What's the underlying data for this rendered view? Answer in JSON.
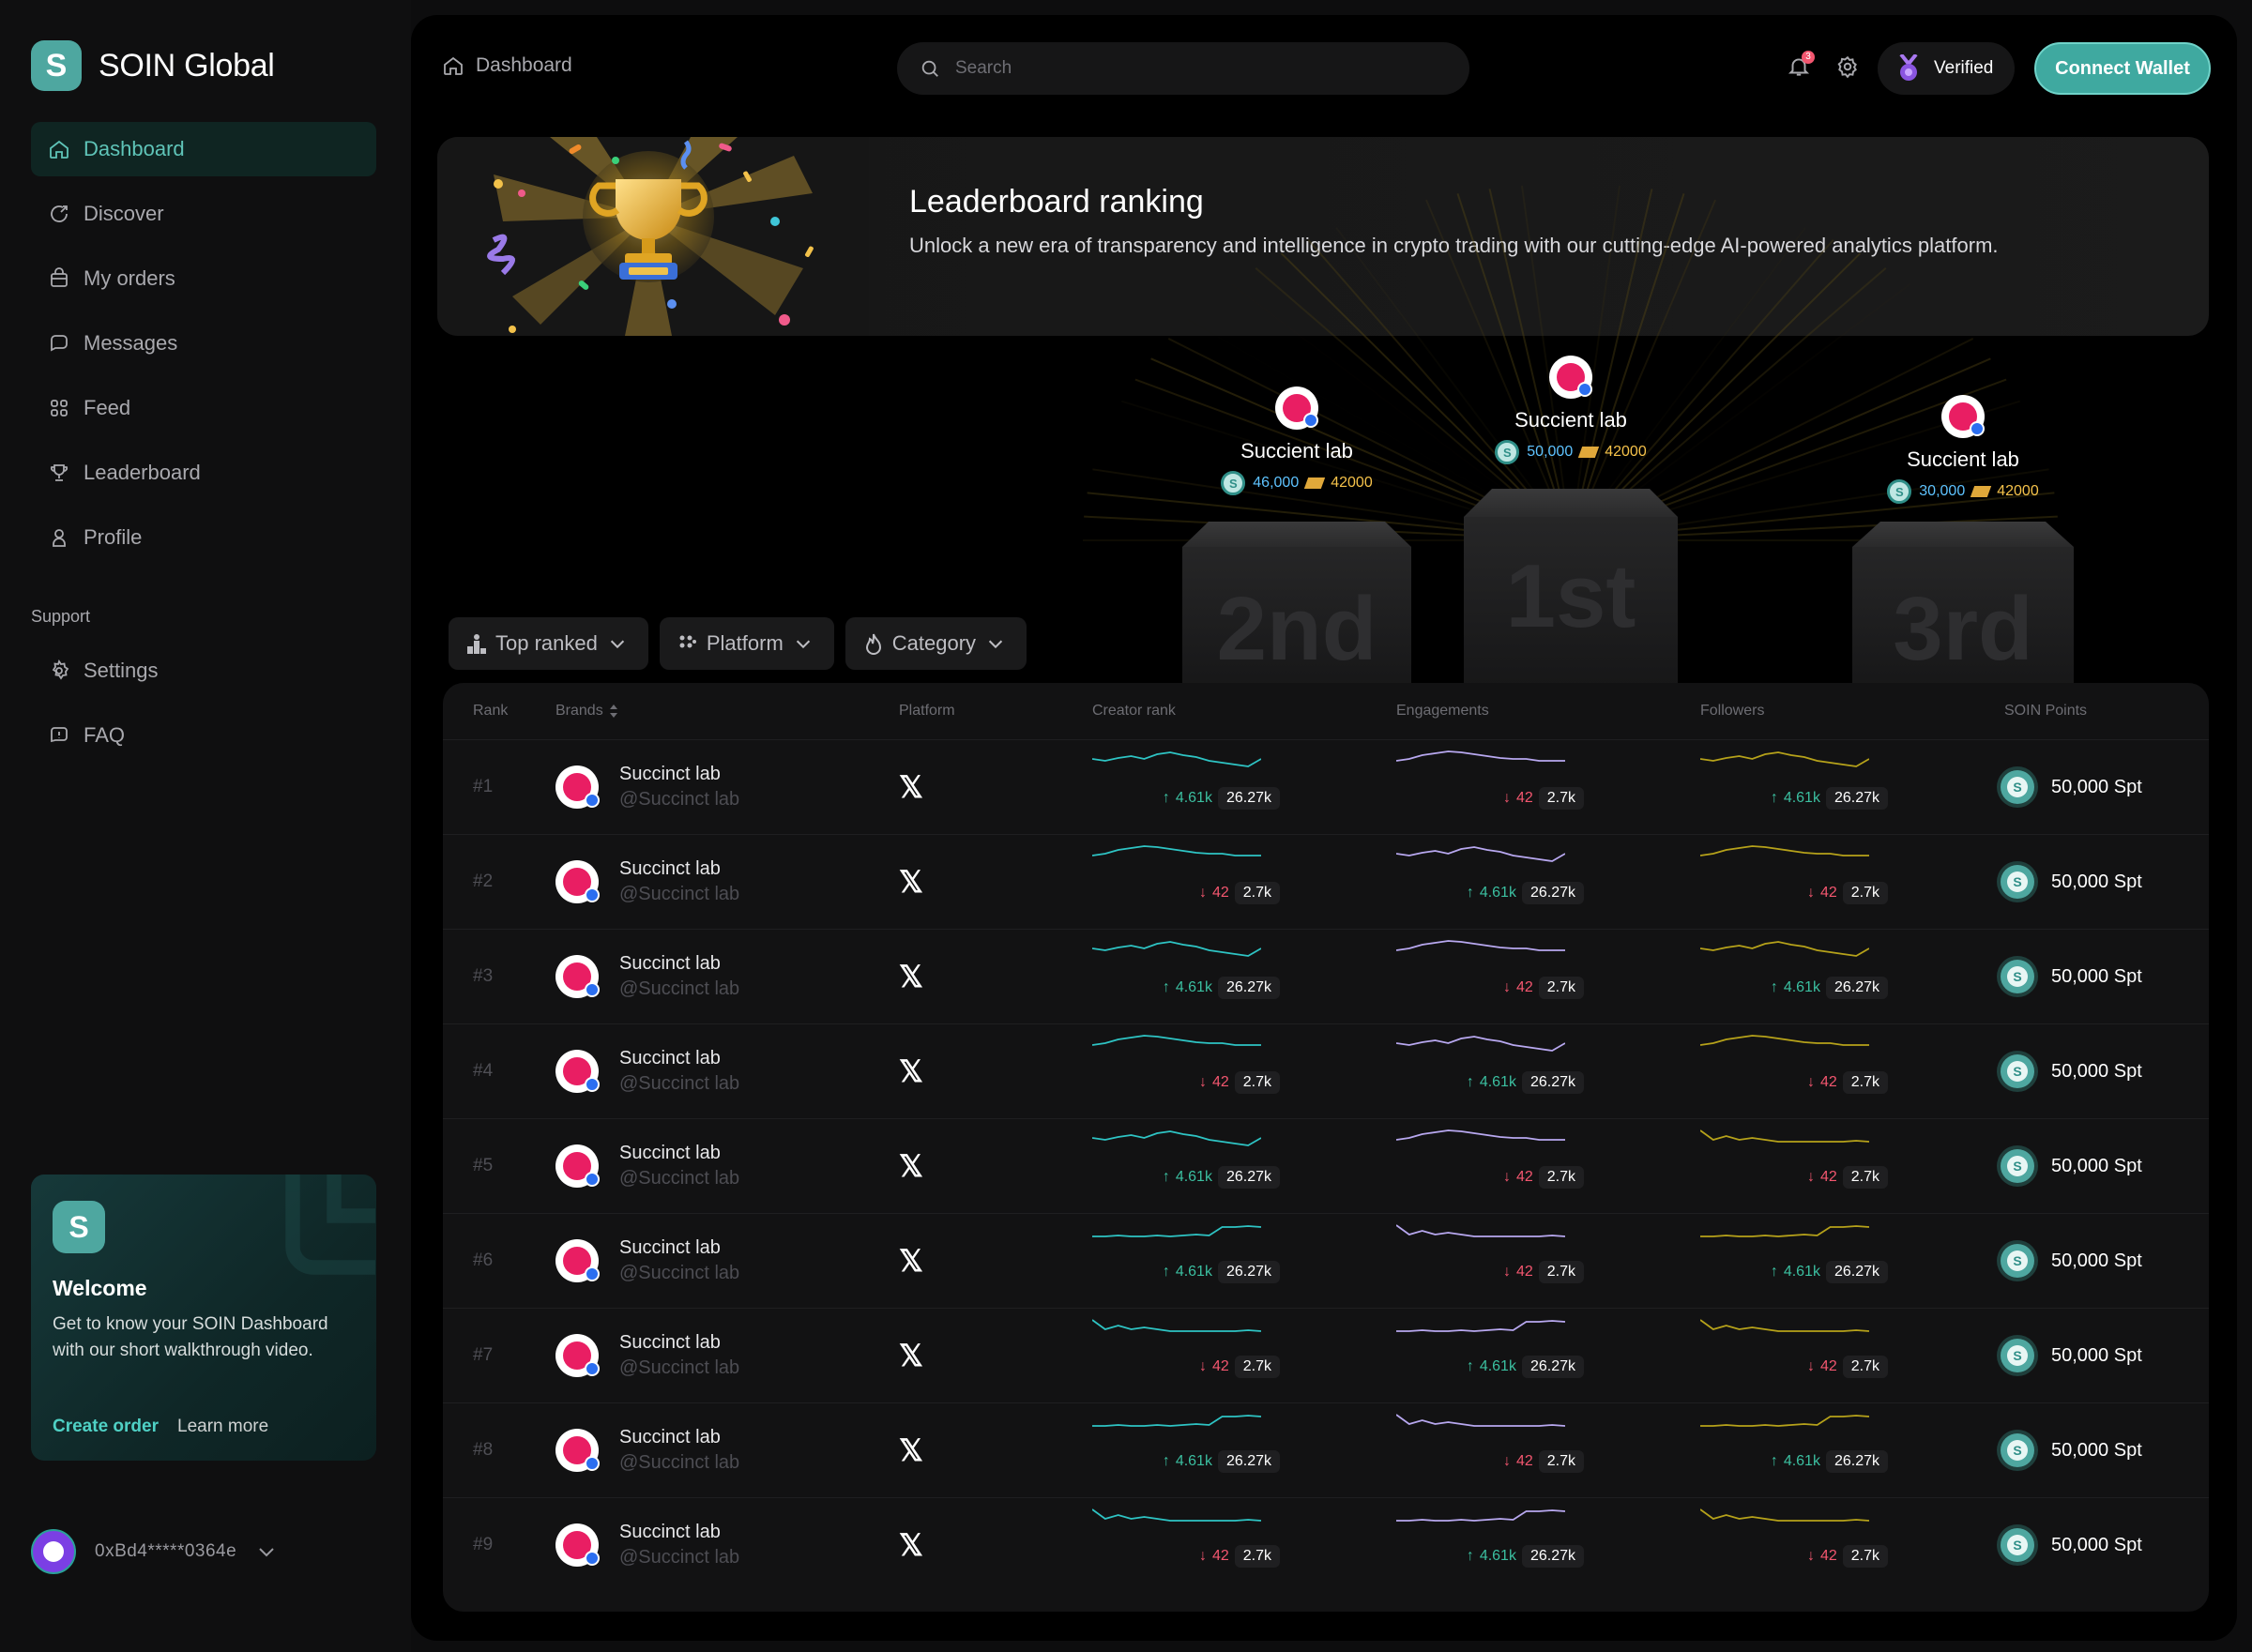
{
  "brand": {
    "name": "SOIN Global",
    "logo_letter": "S"
  },
  "nav": {
    "items": [
      {
        "label": "Dashboard",
        "icon": "home-icon",
        "active": true
      },
      {
        "label": "Discover",
        "icon": "discover-icon"
      },
      {
        "label": "My orders",
        "icon": "orders-icon"
      },
      {
        "label": "Messages",
        "icon": "messages-icon"
      },
      {
        "label": "Feed",
        "icon": "feed-icon"
      },
      {
        "label": "Leaderboard",
        "icon": "trophy-icon"
      },
      {
        "label": "Profile",
        "icon": "profile-icon"
      }
    ],
    "support_label": "Support",
    "support_items": [
      {
        "label": "Settings",
        "icon": "gear-icon"
      },
      {
        "label": "FAQ",
        "icon": "faq-icon"
      }
    ]
  },
  "welcome": {
    "title": "Welcome",
    "description": "Get to know your SOIN Dashboard with our short walkthrough video.",
    "primary_link": "Create order",
    "secondary_link": "Learn more"
  },
  "account": {
    "address": "0xBd4*****0364e"
  },
  "header": {
    "breadcrumb": "Dashboard",
    "search_placeholder": "Search",
    "notification_count": "3",
    "verified_label": "Verified",
    "connect_label": "Connect Wallet"
  },
  "banner": {
    "title": "Leaderboard ranking",
    "description": "Unlock a new era of transparency and intelligence in crypto trading with our cutting-edge AI-powered analytics platform."
  },
  "podium": [
    {
      "place": "2nd",
      "name": "Succient lab",
      "points": "46,000",
      "tokens": "42000"
    },
    {
      "place": "1st",
      "name": "Succient lab",
      "points": "50,000",
      "tokens": "42000"
    },
    {
      "place": "3rd",
      "name": "Succient lab",
      "points": "30,000",
      "tokens": "42000"
    }
  ],
  "filters": [
    {
      "label": "Top ranked",
      "icon": "podium-icon"
    },
    {
      "label": "Platform",
      "icon": "platform-icon"
    },
    {
      "label": "Category",
      "icon": "flame-icon"
    }
  ],
  "table": {
    "columns": [
      "Rank",
      "Brands",
      "Platform",
      "Creator rank",
      "Engagements",
      "Followers",
      "SOIN Points"
    ],
    "rows": [
      {
        "rank": "#1",
        "name": "Succinct lab",
        "handle": "@Succinct lab",
        "platform": "𝕏",
        "creator": {
          "dir": "up",
          "delta": "4.61k",
          "value": "26.27k"
        },
        "engagements": {
          "dir": "down",
          "delta": "42",
          "value": "2.7k"
        },
        "followers": {
          "dir": "up",
          "delta": "4.61k",
          "value": "26.27k"
        },
        "points": "50,000 Spt"
      },
      {
        "rank": "#2",
        "name": "Succinct lab",
        "handle": "@Succinct lab",
        "platform": "𝕏",
        "creator": {
          "dir": "down",
          "delta": "42",
          "value": "2.7k"
        },
        "engagements": {
          "dir": "up",
          "delta": "4.61k",
          "value": "26.27k"
        },
        "followers": {
          "dir": "down",
          "delta": "42",
          "value": "2.7k"
        },
        "points": "50,000 Spt"
      },
      {
        "rank": "#3",
        "name": "Succinct lab",
        "handle": "@Succinct lab",
        "platform": "𝕏",
        "creator": {
          "dir": "up",
          "delta": "4.61k",
          "value": "26.27k"
        },
        "engagements": {
          "dir": "down",
          "delta": "42",
          "value": "2.7k"
        },
        "followers": {
          "dir": "up",
          "delta": "4.61k",
          "value": "26.27k"
        },
        "points": "50,000 Spt"
      },
      {
        "rank": "#4",
        "name": "Succinct lab",
        "handle": "@Succinct lab",
        "platform": "𝕏",
        "creator": {
          "dir": "down",
          "delta": "42",
          "value": "2.7k"
        },
        "engagements": {
          "dir": "up",
          "delta": "4.61k",
          "value": "26.27k"
        },
        "followers": {
          "dir": "down",
          "delta": "42",
          "value": "2.7k"
        },
        "points": "50,000 Spt"
      },
      {
        "rank": "#5",
        "name": "Succinct lab",
        "handle": "@Succinct lab",
        "platform": "𝕏",
        "creator": {
          "dir": "up",
          "delta": "4.61k",
          "value": "26.27k"
        },
        "engagements": {
          "dir": "down",
          "delta": "42",
          "value": "2.7k"
        },
        "followers": {
          "dir": "down",
          "delta": "42",
          "value": "2.7k"
        },
        "points": "50,000 Spt"
      },
      {
        "rank": "#6",
        "name": "Succinct lab",
        "handle": "@Succinct lab",
        "platform": "𝕏",
        "creator": {
          "dir": "up",
          "delta": "4.61k",
          "value": "26.27k"
        },
        "engagements": {
          "dir": "down",
          "delta": "42",
          "value": "2.7k"
        },
        "followers": {
          "dir": "up",
          "delta": "4.61k",
          "value": "26.27k"
        },
        "points": "50,000 Spt"
      },
      {
        "rank": "#7",
        "name": "Succinct lab",
        "handle": "@Succinct lab",
        "platform": "𝕏",
        "creator": {
          "dir": "down",
          "delta": "42",
          "value": "2.7k"
        },
        "engagements": {
          "dir": "up",
          "delta": "4.61k",
          "value": "26.27k"
        },
        "followers": {
          "dir": "down",
          "delta": "42",
          "value": "2.7k"
        },
        "points": "50,000 Spt"
      },
      {
        "rank": "#8",
        "name": "Succinct lab",
        "handle": "@Succinct lab",
        "platform": "𝕏",
        "creator": {
          "dir": "up",
          "delta": "4.61k",
          "value": "26.27k"
        },
        "engagements": {
          "dir": "down",
          "delta": "42",
          "value": "2.7k"
        },
        "followers": {
          "dir": "up",
          "delta": "4.61k",
          "value": "26.27k"
        },
        "points": "50,000 Spt"
      },
      {
        "rank": "#9",
        "name": "Succinct lab",
        "handle": "@Succinct lab",
        "platform": "𝕏",
        "creator": {
          "dir": "down",
          "delta": "42",
          "value": "2.7k"
        },
        "engagements": {
          "dir": "up",
          "delta": "4.61k",
          "value": "26.27k"
        },
        "followers": {
          "dir": "down",
          "delta": "42",
          "value": "2.7k"
        },
        "points": "50,000 Spt"
      }
    ]
  },
  "colors": {
    "accent": "#3fa9a0",
    "creator_line": "#2ec4c4",
    "engagement_line": "#b8a8f0",
    "follower_line": "#b6a21a",
    "up": "#3bbfa0",
    "down": "#f2566f"
  }
}
